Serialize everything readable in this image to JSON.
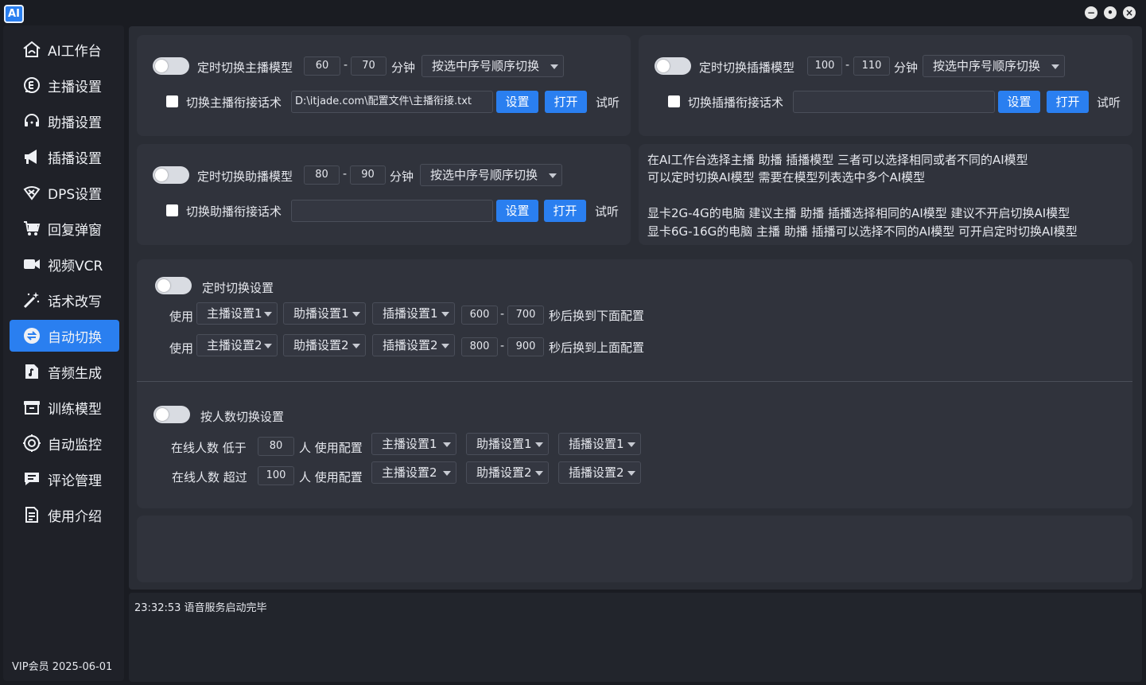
{
  "app": {
    "logo_text": "AI",
    "min_glyph": "−",
    "max_glyph": "•",
    "close_glyph": "×"
  },
  "sidebar": {
    "items": [
      {
        "label": "AI工作台",
        "icon": "home-icon"
      },
      {
        "label": "主播设置",
        "icon": "anchor-icon"
      },
      {
        "label": "助播设置",
        "icon": "headset-icon"
      },
      {
        "label": "插播设置",
        "icon": "megaphone-icon"
      },
      {
        "label": "DPS设置",
        "icon": "dps-icon"
      },
      {
        "label": "回复弹窗",
        "icon": "cart-icon"
      },
      {
        "label": "视频VCR",
        "icon": "video-icon"
      },
      {
        "label": "话术改写",
        "icon": "magic-wand-icon"
      },
      {
        "label": "自动切换",
        "icon": "switch-icon",
        "active": true
      },
      {
        "label": "音频生成",
        "icon": "music-icon"
      },
      {
        "label": "训练模型",
        "icon": "box-icon"
      },
      {
        "label": "自动监控",
        "icon": "monitor-icon"
      },
      {
        "label": "评论管理",
        "icon": "comment-icon"
      },
      {
        "label": "使用介绍",
        "icon": "doc-icon"
      }
    ],
    "vip": "VIP会员  2025-06-01"
  },
  "anchor_panel": {
    "toggle_label": "定时切换主播模型",
    "min": "60",
    "dash": "-",
    "max": "70",
    "unit": "分钟",
    "mode": "按选中序号顺序切换",
    "check_label": "切换主播衔接话术",
    "path": "D:\\itjade.com\\配置文件\\主播衔接.txt",
    "set": "设置",
    "open": "打开",
    "listen": "试听"
  },
  "insert_panel": {
    "toggle_label": "定时切换插播模型",
    "min": "100",
    "dash": "-",
    "max": "110",
    "unit": "分钟",
    "mode": "按选中序号顺序切换",
    "check_label": "切换插播衔接话术",
    "path": "",
    "set": "设置",
    "open": "打开",
    "listen": "试听"
  },
  "assist_panel": {
    "toggle_label": "定时切换助播模型",
    "min": "80",
    "dash": "-",
    "max": "90",
    "unit": "分钟",
    "mode": "按选中序号顺序切换",
    "check_label": "切换助播衔接话术",
    "path": "",
    "set": "设置",
    "open": "打开",
    "listen": "试听"
  },
  "info": {
    "line1": "在AI工作台选择主播  助播  插播模型  三者可以选择相同或者不同的AI模型",
    "line2": "可以定时切换AI模型  需要在模型列表选中多个AI模型",
    "line3": "显卡2G-4G的电脑  建议主播  助播  插播选择相同的AI模型  建议不开启切换AI模型",
    "line4": "显卡6G-16G的电脑  主播  助播  插播可以选择不同的AI模型  可开启定时切换AI模型"
  },
  "timer_switch": {
    "title": "定时切换设置",
    "row1": {
      "use": "使用",
      "anchor": "主播设置1",
      "assist": "助播设置1",
      "insert": "插播设置1",
      "min": "600",
      "dash": "-",
      "max": "700",
      "suffix": "秒后换到下面配置"
    },
    "row2": {
      "use": "使用",
      "anchor": "主播设置2",
      "assist": "助播设置2",
      "insert": "插播设置2",
      "min": "800",
      "dash": "-",
      "max": "900",
      "suffix": "秒后换到上面配置"
    }
  },
  "count_switch": {
    "title": "按人数切换设置",
    "row1": {
      "prefix": "在线人数 低于",
      "count": "80",
      "mid": "人 使用配置",
      "anchor": "主播设置1",
      "assist": "助播设置1",
      "insert": "插播设置1"
    },
    "row2": {
      "prefix": "在线人数 超过",
      "count": "100",
      "mid": "人 使用配置",
      "anchor": "主播设置2",
      "assist": "助播设置2",
      "insert": "插播设置2"
    }
  },
  "log": {
    "line": "23:32:53 语音服务启动完毕"
  },
  "colors": {
    "accent": "#2a7ff0",
    "background": "#1a1c22",
    "panel": "#30333c"
  }
}
